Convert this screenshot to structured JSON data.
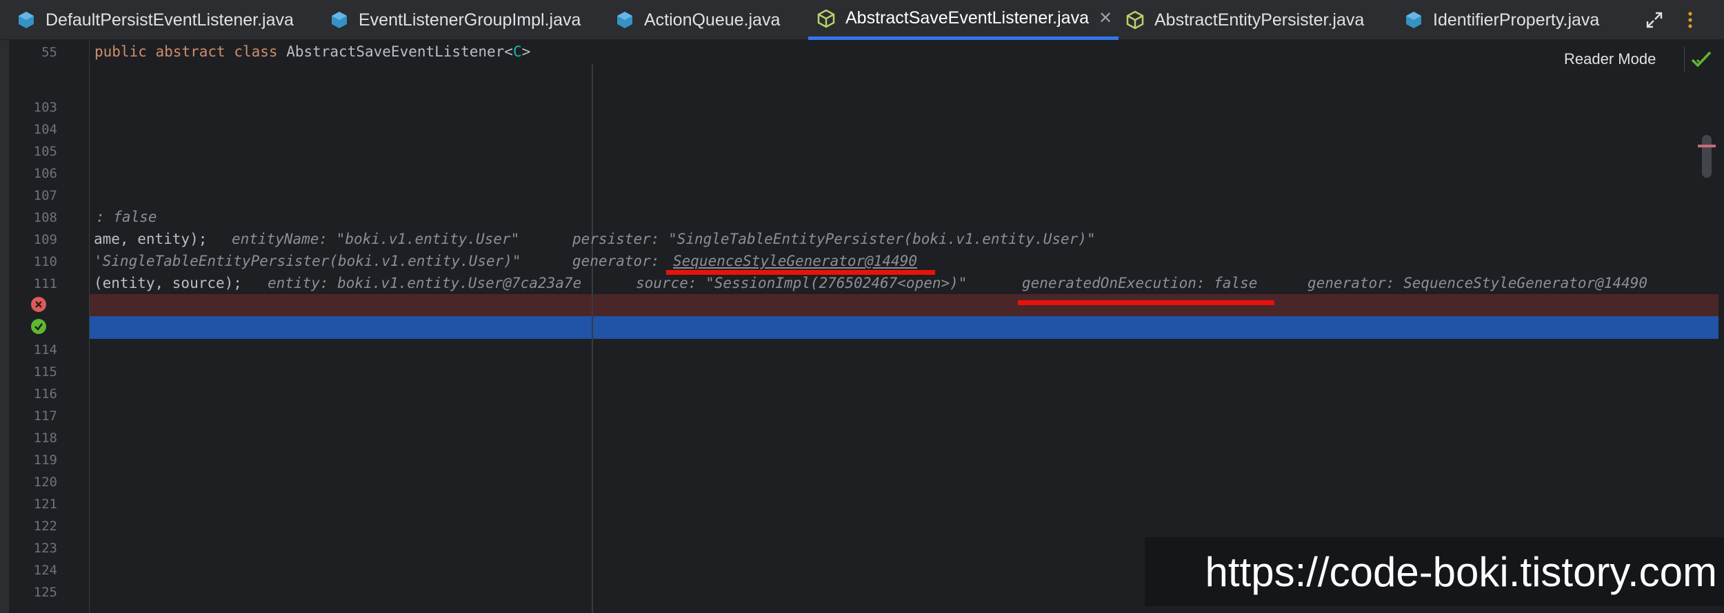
{
  "tabs": [
    {
      "label": "DefaultPersistEventListener.java",
      "icon": "java-class-icon",
      "active": false
    },
    {
      "label": "EventListenerGroupImpl.java",
      "icon": "java-class-icon",
      "active": false
    },
    {
      "label": "ActionQueue.java",
      "icon": "java-class-icon",
      "active": false
    },
    {
      "label": "AbstractSaveEventListener.java",
      "icon": "java-abstract-class-icon",
      "active": true
    },
    {
      "label": "AbstractEntityPersister.java",
      "icon": "java-abstract-class-icon",
      "active": false
    },
    {
      "label": "IdentifierProperty.java",
      "icon": "java-class-icon",
      "active": false
    }
  ],
  "toolbar": {
    "expand_icon": "expand-icon",
    "more_icon": "more-vertical-icon"
  },
  "reader_mode": "Reader Mode",
  "line_numbers": [
    "55",
    "103",
    "104",
    "105",
    "106",
    "107",
    "108",
    "109",
    "110",
    "111",
    "114",
    "115",
    "116",
    "117",
    "118",
    "119",
    "120",
    "121",
    "122",
    "123",
    "124",
    "125"
  ],
  "code": {
    "line55": {
      "kw1": "public",
      "kw2": "abstract",
      "kw3": "class",
      "name": "AbstractSaveEventListener",
      "generic_open": "<",
      "generic": "C",
      "generic_close": ">"
    },
    "line108": ": false",
    "line109_code": "ame, entity);",
    "line109_hint1": "entityName: \"boki.v1.entity.User\"",
    "line109_hint2": "persister: \"SingleTableEntityPersister(boki.v1.entity.User)\"",
    "line110_hint1": "'SingleTableEntityPersister(boki.v1.entity.User)\"",
    "line110_hint2": "generator:",
    "line110_hint3": "SequenceStyleGenerator@14490",
    "line111_code": "(entity, source);",
    "line111_hint1": "entity: boki.v1.entity.User@7ca23a7e",
    "line111_hint2": "source: \"SessionImpl(276502467<open>)\"",
    "line111_hint3": "generatedOnExecution: false",
    "line111_hint4": "generator: SequenceStyleGenerator@14490"
  },
  "gutter_icons": {
    "error": "breakpoint-error-icon",
    "ok": "breakpoint-verified-icon"
  },
  "colors": {
    "accent": "#3574f0",
    "underline": "#e8120c",
    "exec_line": "#2153a6",
    "error_line": "#4a2628"
  },
  "watermark": "https://code-boki.tistory.com"
}
